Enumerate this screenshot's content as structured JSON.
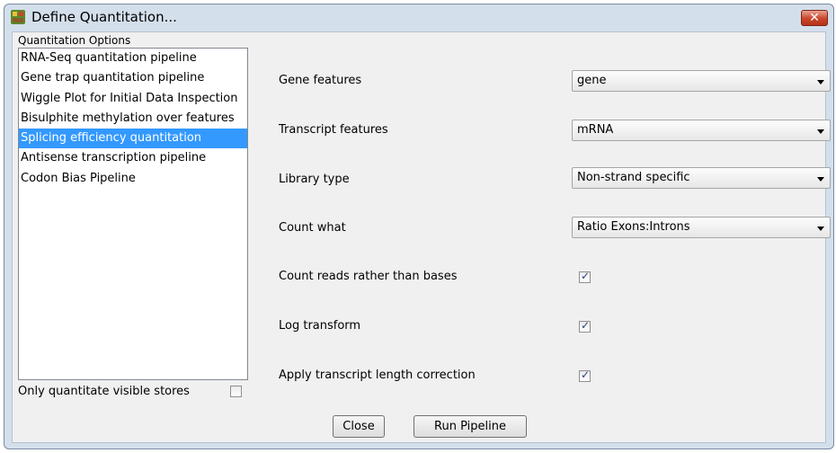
{
  "window": {
    "title": "Define Quantitation..."
  },
  "options_group": {
    "label": "Quantitation Options",
    "items": [
      "RNA-Seq quantitation pipeline",
      "Gene trap quantitation pipeline",
      "Wiggle Plot for Initial Data Inspection",
      "Bisulphite methylation over features",
      "Splicing efficiency quantitation",
      "Antisense transcription pipeline",
      "Codon Bias Pipeline"
    ],
    "selected_item": "Splicing efficiency quantitation",
    "visible_stores_label": "Only quantitate visible stores",
    "visible_stores_checked": false
  },
  "form": {
    "gene_features": {
      "label": "Gene features",
      "value": "gene"
    },
    "transcript_features": {
      "label": "Transcript features",
      "value": "mRNA"
    },
    "library_type": {
      "label": "Library type",
      "value": "Non-strand specific"
    },
    "count_what": {
      "label": "Count what",
      "value": "Ratio Exons:Introns"
    },
    "count_reads": {
      "label": "Count reads rather than bases",
      "checked": true
    },
    "log_transform": {
      "label": "Log transform",
      "checked": true
    },
    "length_correction": {
      "label": "Apply transcript length correction",
      "checked": true
    }
  },
  "buttons": {
    "close": "Close",
    "run": "Run Pipeline"
  }
}
